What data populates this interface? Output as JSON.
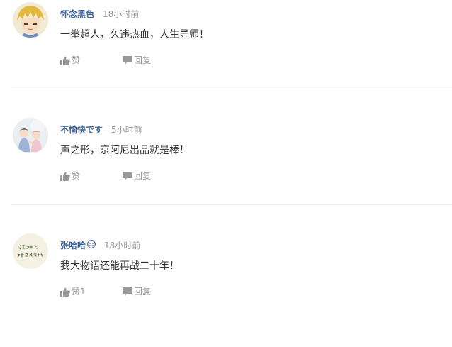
{
  "comments": [
    {
      "username": "怀念黑色",
      "time": "18小时前",
      "text": "一拳超人，久违热血，人生导师！",
      "like_label": "赞",
      "reply_label": "回复",
      "avatar_icon": "anime-character-avatar",
      "has_badge": false
    },
    {
      "username": "不愉快です",
      "time": "5小时前",
      "text": "声之形，京阿尼出品就是棒！",
      "like_label": "赞",
      "reply_label": "回复",
      "avatar_icon": "anime-couple-avatar",
      "has_badge": false
    },
    {
      "username": "张哈哈",
      "time": "18小时前",
      "text": "我大物语还能再战二十年！",
      "like_label": "赞1",
      "reply_label": "回复",
      "avatar_icon": "calligraphy-avatar",
      "has_badge": true,
      "badge_icon": "smiley-badge-icon"
    }
  ],
  "colors": {
    "username": "#406599",
    "time": "#999999",
    "text": "#333333",
    "action": "#999999",
    "divider": "#ececec"
  }
}
